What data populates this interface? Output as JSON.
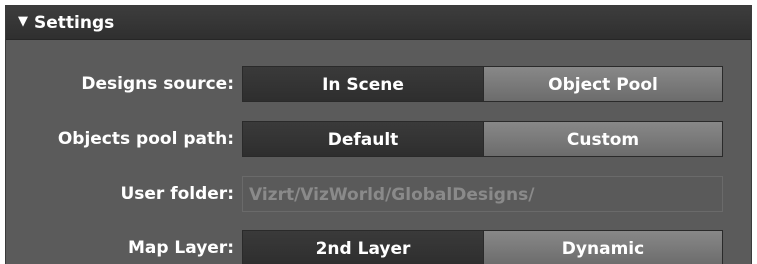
{
  "panel": {
    "title": "Settings",
    "collapse_icon": "triangle-down-icon"
  },
  "rows": {
    "designs_source": {
      "label": "Designs source:",
      "options": [
        "In Scene",
        "Object Pool"
      ],
      "selected": "In Scene"
    },
    "objects_pool_path": {
      "label": "Objects pool path:",
      "options": [
        "Default",
        "Custom"
      ],
      "selected": "Default"
    },
    "user_folder": {
      "label": "User folder:",
      "value": "Vizrt/VizWorld/GlobalDesigns/"
    },
    "map_layer": {
      "label": "Map Layer:",
      "options": [
        "2nd Layer",
        "Dynamic"
      ],
      "selected": "2nd Layer"
    }
  },
  "colors": {
    "panel_bg": "#5b5b5b",
    "header_bg": "#343434",
    "selected_segment": "#333333",
    "unselected_segment": "#7a7a7a",
    "disabled_text": "#8a8a8a"
  }
}
